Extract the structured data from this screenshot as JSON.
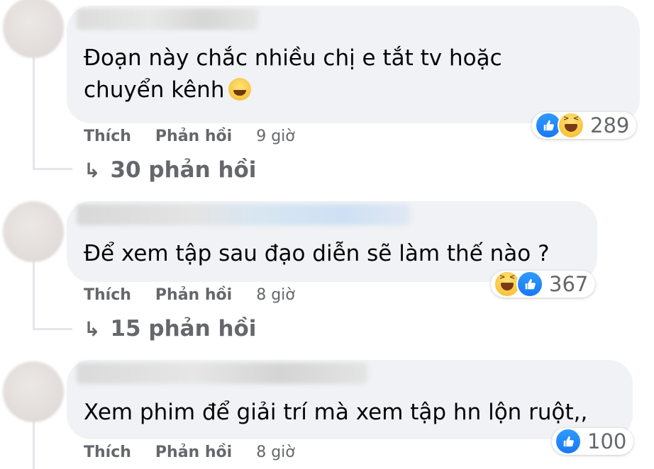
{
  "colors": {
    "bubble": "#f0f2f5",
    "secondary_text": "#65676b",
    "like_blue": "#1877f2",
    "haha_yellow": "#f7b924"
  },
  "comments": [
    {
      "text_line1": "Đoạn này chắc nhiều chị e tắt tv hoặc",
      "text_line2": "chuyển kênh",
      "reaction_icons": [
        "like-icon",
        "haha-icon"
      ],
      "reaction_count": "289",
      "like": "Thích",
      "reply": "Phản hồi",
      "time": "9 giờ",
      "replies": "30 phản hồi"
    },
    {
      "text_line1": "Để xem tập sau đạo diễn sẽ làm thế nào ?",
      "reaction_icons": [
        "haha-icon",
        "like-icon"
      ],
      "reaction_count": "367",
      "like": "Thích",
      "reply": "Phản hồi",
      "time": "8 giờ",
      "replies": "15 phản hồi"
    },
    {
      "text_line1": "Xem phim để giải trí mà xem tập hn lộn ruột,,",
      "reaction_icons": [
        "like-icon"
      ],
      "reaction_count": "100",
      "like": "Thích",
      "reply": "Phản hồi",
      "time": "8 giờ"
    }
  ]
}
